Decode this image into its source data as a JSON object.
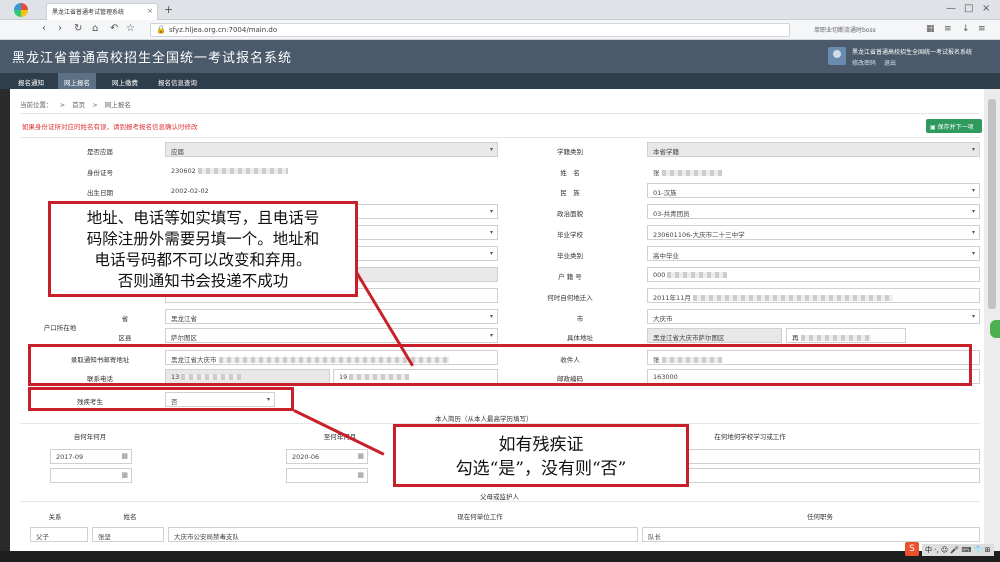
{
  "browser": {
    "tab_title": "黑龙江省普通考试管理系统",
    "tab_close": "×",
    "new_tab": "+",
    "url": "sfyz.hljea.org.cn:7004/main.do",
    "search_hint": "单职业切断流通时boss",
    "window_controls": [
      "—",
      "□",
      "×"
    ]
  },
  "header": {
    "app_title": "黑龙江省普通高校招生全国统一考试报名系统",
    "user_name": "黑龙江省普通高校招生全国统一考试报名系统",
    "links": [
      "修改密码",
      "退出"
    ]
  },
  "nav": [
    "报名通知",
    "网上报名",
    "网上缴费",
    "报名信息查询"
  ],
  "breadcrumb": [
    "当前位置：",
    ">",
    "首页",
    ">",
    "网上报名"
  ],
  "notice": "如果身份证所对应的姓名有误，请到报考报名信息确认时修改",
  "save_button": "保存并下一项",
  "form_left": [
    {
      "label": "是否应届",
      "value": "应届"
    },
    {
      "label": "身份证号",
      "value": "230602"
    },
    {
      "label": "出生日期",
      "value": "2002-02-02"
    }
  ],
  "form_right": [
    {
      "label": "学籍类别",
      "value": "本省学籍"
    },
    {
      "label": "姓　名",
      "value": "张"
    },
    {
      "label": "民　族",
      "value": "01-汉族"
    },
    {
      "label": "政治面貌",
      "value": "03-共青团员"
    },
    {
      "label": "毕业学校",
      "value": "230601106-大庆市二十三中学"
    },
    {
      "label": "毕业类别",
      "value": "高中毕业"
    },
    {
      "label": "户 籍 号",
      "value": "000"
    },
    {
      "label": "何时自何地迁入",
      "value": "2011年11月"
    }
  ],
  "hukou": {
    "label": "户口所在地",
    "province_label": "省",
    "province_value": "黑龙江省",
    "district_label": "区县",
    "district_value": "萨尔图区",
    "city_label": "市",
    "city_value": "大庆市",
    "detail_label": "具体地址",
    "detail_value": "黑龙江省大庆市萨尔图区",
    "detail_extra": "再"
  },
  "mail": {
    "address_label": "录取通知书邮寄地址",
    "address_value": "黑龙江省大庆市",
    "receiver_label": "收件人",
    "receiver_value": "张",
    "phone_label": "联系电话",
    "phone1": "13",
    "phone2": "19",
    "zip_label": "邮政编码",
    "zip_value": "163000"
  },
  "disability": {
    "label": "残疾考生",
    "value": "否"
  },
  "resume": {
    "title": "本人简历（从本人最高学历填写）",
    "from_label": "自何年何月",
    "to_label": "至何年何月",
    "school_label": "在何地何学校学习或工作",
    "from_value": "2017-09",
    "to_value": "2020-06"
  },
  "guardian": {
    "title": "父母或监护人",
    "headers": [
      "关系",
      "姓名",
      "现在何单位工作",
      "任何职务"
    ],
    "row": [
      "父子",
      "张坚",
      "大庆市公安局禁毒支队",
      "队长"
    ]
  },
  "annotations": {
    "note1": [
      "地址、电话等如实填写，且电话号",
      "码除注册外需要另填一个。地址和",
      "电话号码都不可以改变和弃用。",
      "否则通知书会投递不成功"
    ],
    "note2": [
      "如有残疾证",
      "勾选“是”，没有则“否”"
    ],
    "color": "#c8202a"
  },
  "tray": {
    "ime": "S",
    "items": "中 ·, ☺ 🎤 ⌨ 👕 ⊞"
  }
}
